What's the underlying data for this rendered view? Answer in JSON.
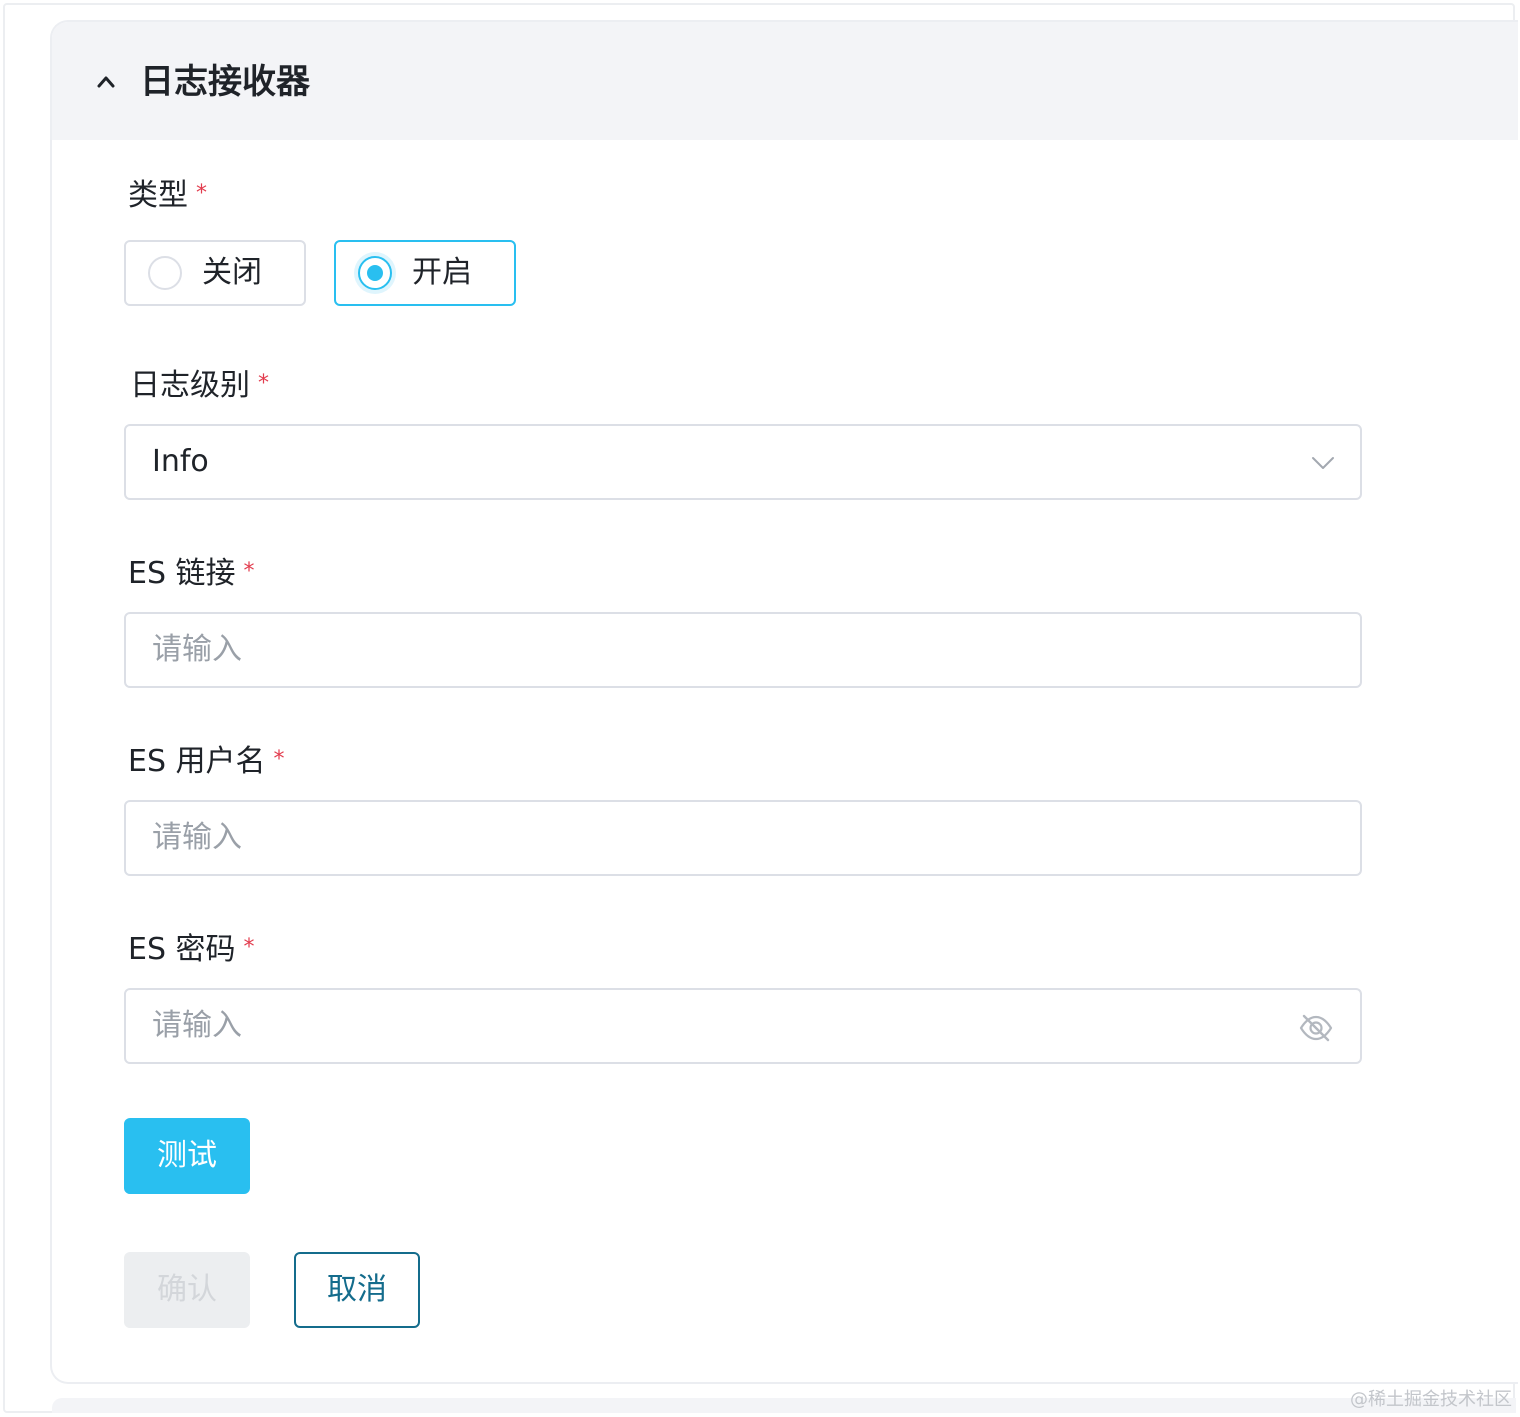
{
  "panel": {
    "title": "日志接收器",
    "collapse_icon": "chevron-up-icon"
  },
  "type_field": {
    "label": "类型",
    "required_mark": "*",
    "options": [
      {
        "label": "关闭",
        "selected": false
      },
      {
        "label": "开启",
        "selected": true
      }
    ]
  },
  "log_level": {
    "label": "日志级别",
    "required_mark": "*",
    "value": "Info",
    "icon": "chevron-down-icon"
  },
  "es_link": {
    "label": "ES 链接",
    "required_mark": "*",
    "placeholder": "请输入",
    "value": ""
  },
  "es_username": {
    "label": "ES 用户名",
    "required_mark": "*",
    "placeholder": "请输入",
    "value": ""
  },
  "es_password": {
    "label": "ES 密码",
    "required_mark": "*",
    "placeholder": "请输入",
    "value": "",
    "icon": "eye-off-icon"
  },
  "buttons": {
    "test": "测试",
    "confirm": "确认",
    "cancel": "取消"
  },
  "watermark": "@稀土掘金技术社区",
  "colors": {
    "primary": "#29bff0",
    "cancel_border": "#146c8c",
    "required": "#e23c4e",
    "header_bg": "#f3f4f7"
  }
}
